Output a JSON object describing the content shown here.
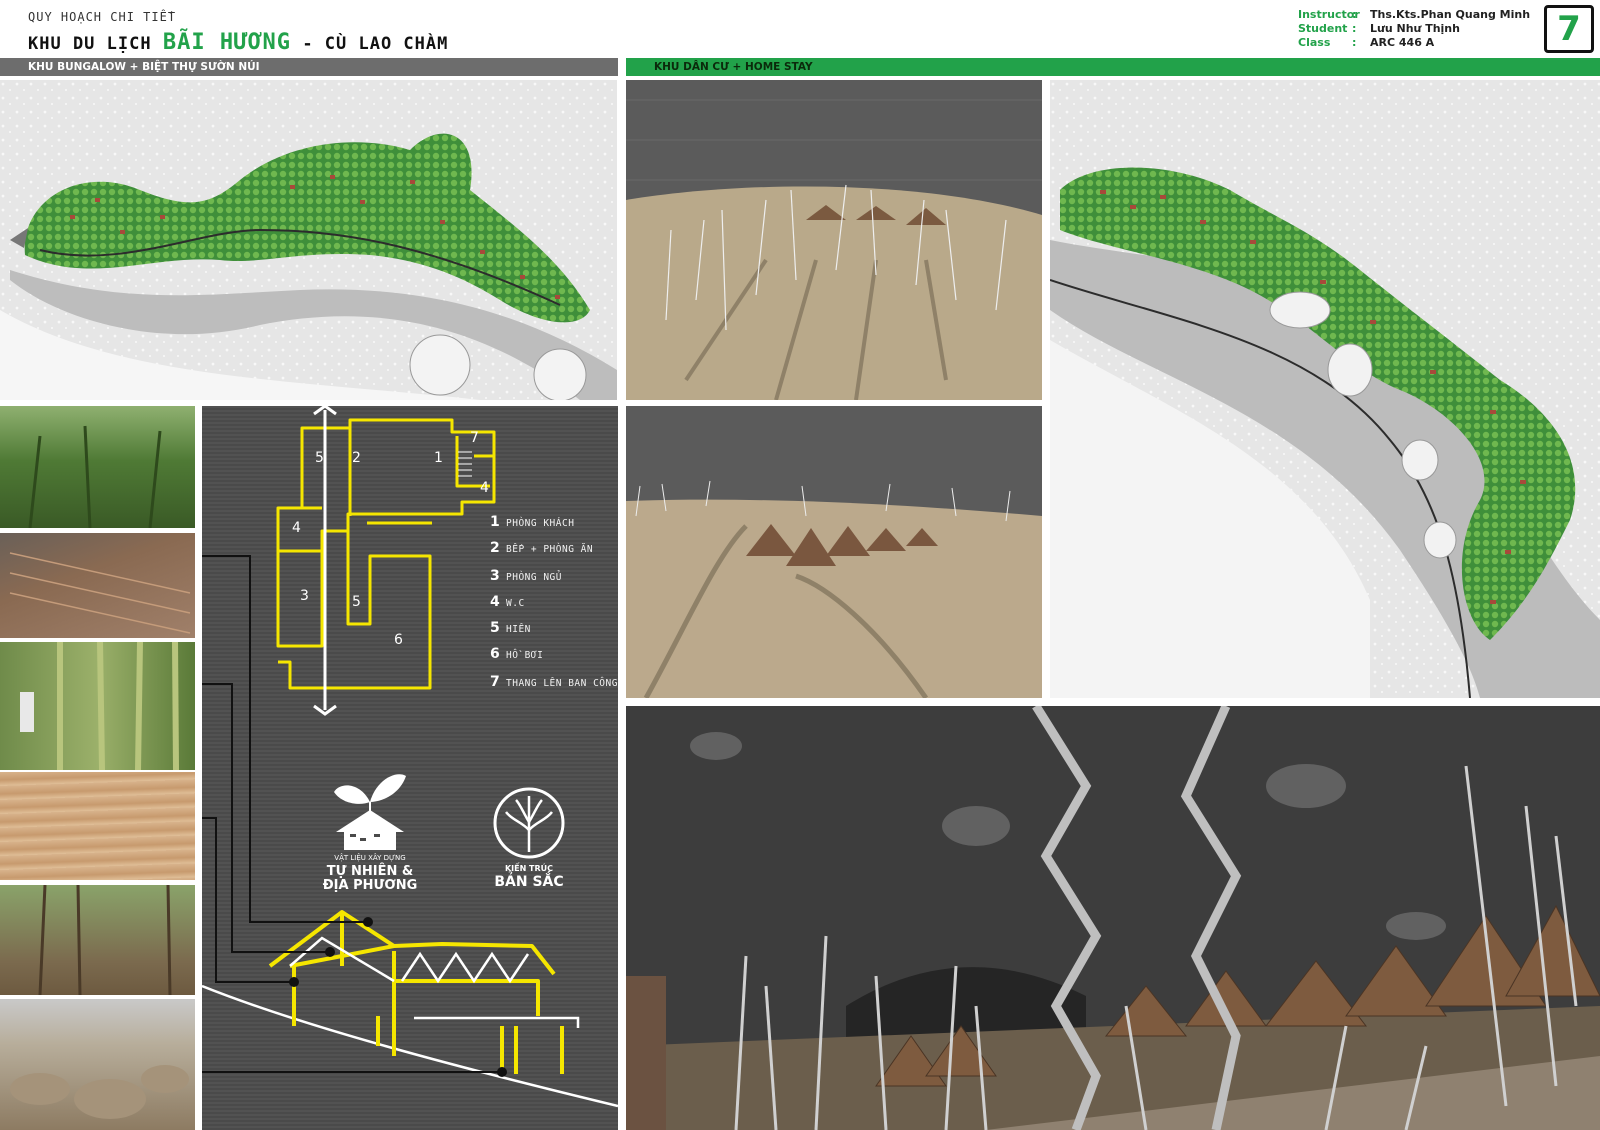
{
  "header": {
    "subtitle": "QUY HOẠCH CHI TIẾT",
    "title_prefix": "KHU DU LỊCH",
    "title_highlight": "BÃI HƯƠNG",
    "title_suffix": "- CÙ LAO CHÀM"
  },
  "credits": {
    "instructor_label": "Instructor",
    "instructor_value": "Ths.Kts.Phan Quang Minh",
    "student_label": "Student",
    "student_value": "Lưu Như Thịnh",
    "class_label": "Class",
    "class_value": "ARC 446 A",
    "separator": ":"
  },
  "page_number": "7",
  "sections": {
    "left": "KHU BUNGALOW + BIỆT THỰ SƯỜN NÚI",
    "right": "KHU DÂN CƯ + HOME STAY"
  },
  "floor_plan": {
    "room_numbers": [
      "5",
      "2",
      "1",
      "7",
      "4",
      "4",
      "3",
      "5",
      "6"
    ],
    "legend": [
      {
        "num": "1",
        "label": "PHÒNG KHÁCH"
      },
      {
        "num": "2",
        "label": "BẾP + PHÒNG ĂN"
      },
      {
        "num": "3",
        "label": "PHÒNG NGỦ"
      },
      {
        "num": "4",
        "label": "W.C"
      },
      {
        "num": "5",
        "label": "HIÊN"
      },
      {
        "num": "6",
        "label": "HỒ BƠI"
      },
      {
        "num": "7",
        "label": "THANG LÊN BAN CÔNG"
      }
    ]
  },
  "logos": {
    "left_small": "VẬT LIỆU XÂY DỰNG",
    "left_line1": "TỰ NHIÊN &",
    "left_line2": "ĐỊA PHƯƠNG",
    "right_small": "KIẾN TRÚC",
    "right_big": "BẢN SẮC"
  },
  "colors": {
    "accent_green": "#22a24a",
    "sketch_yellow": "#f5e600",
    "panel_dark": "#4a4a4a"
  }
}
